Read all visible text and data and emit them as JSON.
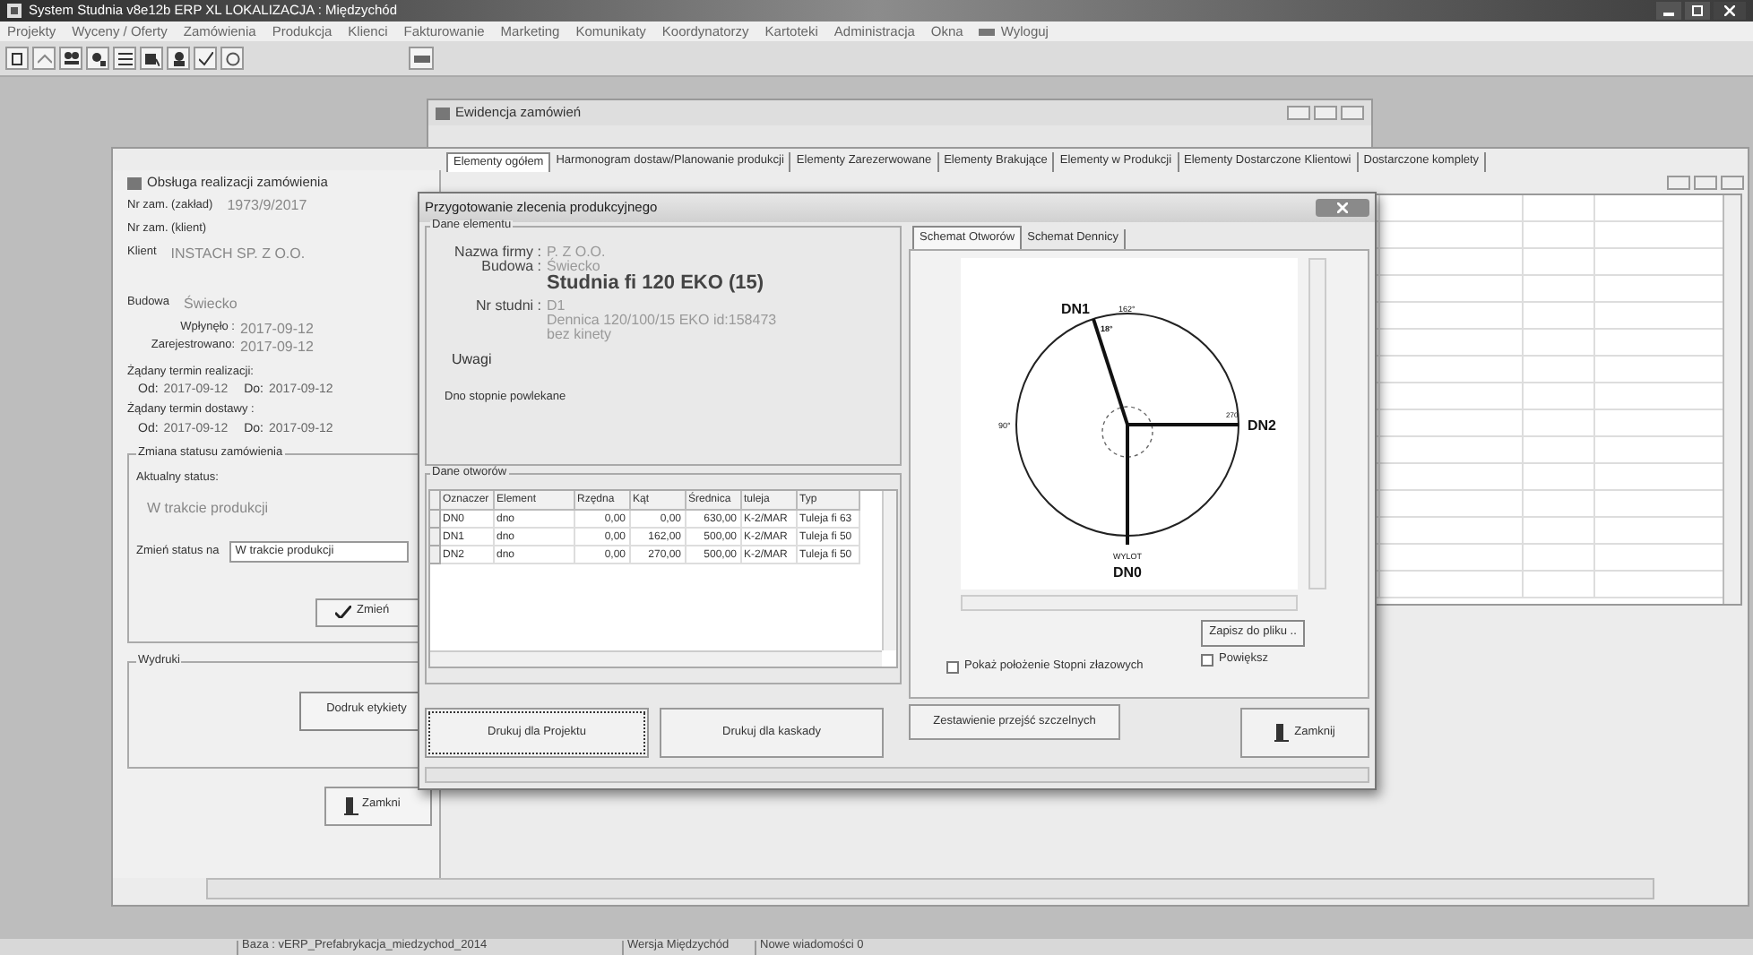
{
  "app": {
    "title": "System Studnia  v8e12b ERP XL  LOKALIZACJA : Międzychód"
  },
  "menu": [
    "Projekty",
    "Wyceny / Oferty",
    "Zamówienia",
    "Produkcja",
    "Klienci",
    "Fakturowanie",
    "Marketing",
    "Komunikaty",
    "Koordynatorzy",
    "Kartoteki",
    "Administracja",
    "Okna",
    "Wyloguj"
  ],
  "back_window": {
    "title": "Ewidencja zamówień"
  },
  "order_window": {
    "title": "Obsługa realizacji zamówienia",
    "fields": [
      {
        "label": "Nr zam. (zakład)",
        "value": "1973/9/2017"
      },
      {
        "label": "Nr zam. (klient)"
      },
      {
        "label": "Klient",
        "value": "INSTACH SP. Z O.O."
      },
      {
        "label": "Budowa",
        "value": "Świecko"
      }
    ],
    "dates": [
      {
        "label": "Wpłynęło :",
        "value": "2017-09-12"
      },
      {
        "label": "Zarejestrowano:",
        "value": "2017-09-12"
      }
    ],
    "ranges": [
      {
        "label": "Żądany termin realizacji:",
        "from_label": "Od:",
        "from": "2017-09-12",
        "to_label": "Do:",
        "to": "2017-09-12"
      },
      {
        "label": "Żądany termin dostawy :",
        "from_label": "Od:",
        "from": "2017-09-12",
        "to_label": "Do:",
        "to": "2017-09-12"
      }
    ],
    "status_group": {
      "title": "Zmiana statusu zamówienia",
      "current_label": "Aktualny status:",
      "current": "W trakcie produkcji",
      "change_label": "Zmień status na",
      "dropdown": "W trakcie produkcji",
      "button": "Zmień"
    },
    "print_group": {
      "title": "Wydruki",
      "button": "Dodruk etykiety"
    },
    "close_button": "Zamkni",
    "tabs": [
      {
        "label": "Elementy ogółem",
        "selected": true
      },
      {
        "label": "Harmonogram dostaw/Planowanie produkcji",
        "selected": false
      },
      {
        "label": "Elementy Zarezerwowane",
        "selected": false
      },
      {
        "label": "Elementy Brakujące",
        "selected": false
      },
      {
        "label": "Elementy w Produkcji",
        "selected": false
      },
      {
        "label": "Elementy Dostarczone Klientowi",
        "selected": false
      },
      {
        "label": "Dostarczone komplety",
        "selected": false
      }
    ]
  },
  "dialog": {
    "title": "Przygotowanie zlecenia produkcyjnego",
    "element_group": {
      "title": "Dane elementu",
      "company_label": "Nazwa firmy :",
      "company": "P. Z O.O.",
      "site_label": "Budowa :",
      "site": "Świecko",
      "heading": "Studnia fi 120 EKO (15)",
      "well_label": "Nr studni :",
      "well": "D1",
      "details": [
        "Dennica 120/100/15 EKO id:158473",
        "bez kinety"
      ],
      "notes_label": "Uwagi",
      "notes": "Dno stopnie powlekane"
    },
    "openings_group": {
      "title": "Dane otworów",
      "columns": [
        "Oznaczer",
        "Element",
        "Rzędna",
        "Kąt",
        "Średnica",
        "tuleja",
        "Typ"
      ],
      "rows": [
        [
          "DN0",
          "dno",
          "0,00",
          "0,00",
          "630,00",
          "K-2/MAR",
          "Tuleja fi 63"
        ],
        [
          "DN1",
          "dno",
          "0,00",
          "162,00",
          "500,00",
          "K-2/MAR",
          "Tuleja fi 50"
        ],
        [
          "DN2",
          "dno",
          "0,00",
          "270,00",
          "500,00",
          "K-2/MAR",
          "Tuleja fi 50"
        ]
      ]
    },
    "tabs": [
      {
        "label": "Schemat Otworów",
        "selected": true
      },
      {
        "label": "Schemat Dennicy",
        "selected": false
      }
    ],
    "schema": {
      "dn1": "DN1",
      "angle_top": "162°",
      "angle_dn1": "18°",
      "angle_left": "90°",
      "angle_dn2": "270",
      "dn2": "DN2",
      "outlet": "WYLOT",
      "dn0": "DN0"
    },
    "save_button": "Zapisz do pliku ..",
    "checkboxes": [
      {
        "label": "Pokaż położenie Stopni złazowych",
        "checked": false
      },
      {
        "label": "Powiększ",
        "checked": false
      }
    ],
    "buttons": [
      {
        "label": "Drukuj dla Projektu",
        "focused": true
      },
      {
        "label": "Drukuj dla kaskady",
        "focused": false
      },
      {
        "label": "Zestawienie przejść szczelnych",
        "focused": false
      }
    ],
    "close_button": "Zamknij"
  },
  "status_bar": [
    "Baza : vERP_Prefabrykacja_miedzychod_2014",
    "Wersja Międzychód",
    "Nowe wiadomości 0"
  ]
}
